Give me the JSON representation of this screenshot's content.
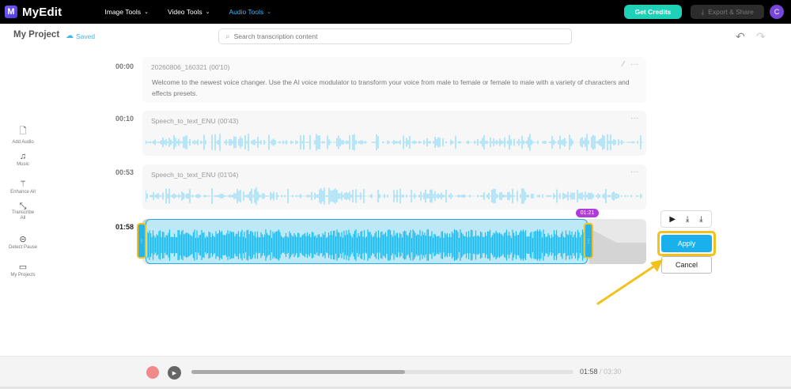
{
  "app": {
    "logo_letter": "M",
    "name": "MyEdit"
  },
  "nav": {
    "items": [
      {
        "label": "Image Tools"
      },
      {
        "label": "Video Tools"
      },
      {
        "label": "Audio Tools"
      }
    ]
  },
  "header": {
    "credits_label": "Get Credits",
    "export_label": "Export & Share",
    "avatar_initial": "C"
  },
  "project": {
    "title": "My Project",
    "saved": "Saved"
  },
  "search": {
    "placeholder": "Search transcription content"
  },
  "sidebar": {
    "items": [
      {
        "label": "Add Audio",
        "icon": "add-audio-icon"
      },
      {
        "label": "Music",
        "icon": "music-icon"
      },
      {
        "label": "Enhance All",
        "icon": "wand-icon"
      },
      {
        "label": "Transcribe All",
        "icon": "transcribe-icon"
      },
      {
        "label": "Detect Pause",
        "icon": "pause-icon"
      },
      {
        "label": "My Projects",
        "icon": "folder-icon"
      }
    ]
  },
  "tracks": [
    {
      "time": "00:00",
      "title": "20260806_160321  (00'10)",
      "text": "Welcome to the newest voice changer. Use the AI voice modulator to transform your voice from male to female or female to male with a variety of characters and effects presets."
    },
    {
      "time": "00:10",
      "title": "Speech_to_text_ENU  (00'43)"
    },
    {
      "time": "00:53",
      "title": "Speech_to_text_ENU  (01'04)"
    },
    {
      "time": "01:58"
    }
  ],
  "selection": {
    "badge": "01:21"
  },
  "actions": {
    "apply": "Apply",
    "cancel": "Cancel"
  },
  "player": {
    "current": "01:58",
    "total": " / 03:30",
    "progress": 0.56
  },
  "colors": {
    "accent": "#1ab0ec",
    "highlight": "#f3c21a",
    "credits": "#1fd1b6",
    "badge": "#b03bd8",
    "avatar": "#7646d9"
  }
}
